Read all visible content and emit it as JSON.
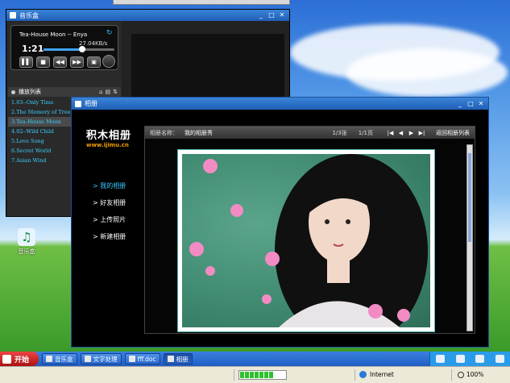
{
  "music_player": {
    "title": "音乐盒",
    "song": "Tea-House Moon -- Enya",
    "rate": "27.04KB/s",
    "time": "1:21",
    "progress_fraction": 0.55,
    "controls": [
      "play",
      "stop",
      "previous",
      "next",
      "repeat"
    ],
    "playlist_title": "播放列表",
    "playlist": [
      "1.03--Only Time",
      "2.The Memory of Trees",
      "3.Tea-House Moon",
      "4.02--Wild Child",
      "5.Love Song",
      "6.Secret World",
      "7.Asian Wind"
    ],
    "active_track_index": 2
  },
  "album": {
    "title": "相册",
    "logo": "积木相册",
    "logo_url": "www.ijimu.cn",
    "nav": [
      "> 我的相册",
      "> 好友相册",
      "> 上传照片",
      "> 新建相册"
    ],
    "active_nav_index": 0,
    "name_label": "相册名称：",
    "name_value": "我的相册秀",
    "count": "1/3张",
    "pages": "1/1页",
    "back_label": "返回相册列表"
  },
  "desktop_icon": {
    "label": "音乐盒"
  },
  "taskbar": {
    "start": "开始",
    "tasks": [
      "音乐盒",
      "文字处理",
      "fff.doc",
      "相册"
    ],
    "active_task_index": 3
  },
  "statusbar": {
    "zone": "Internet",
    "zoom": "100%",
    "progress_fraction": 0.85
  },
  "colors": {
    "title_blue": "#2a6fcc",
    "playlist_text": "#3bd0ff",
    "nav_active": "#35c8ff",
    "logo_url": "#f0a000"
  }
}
